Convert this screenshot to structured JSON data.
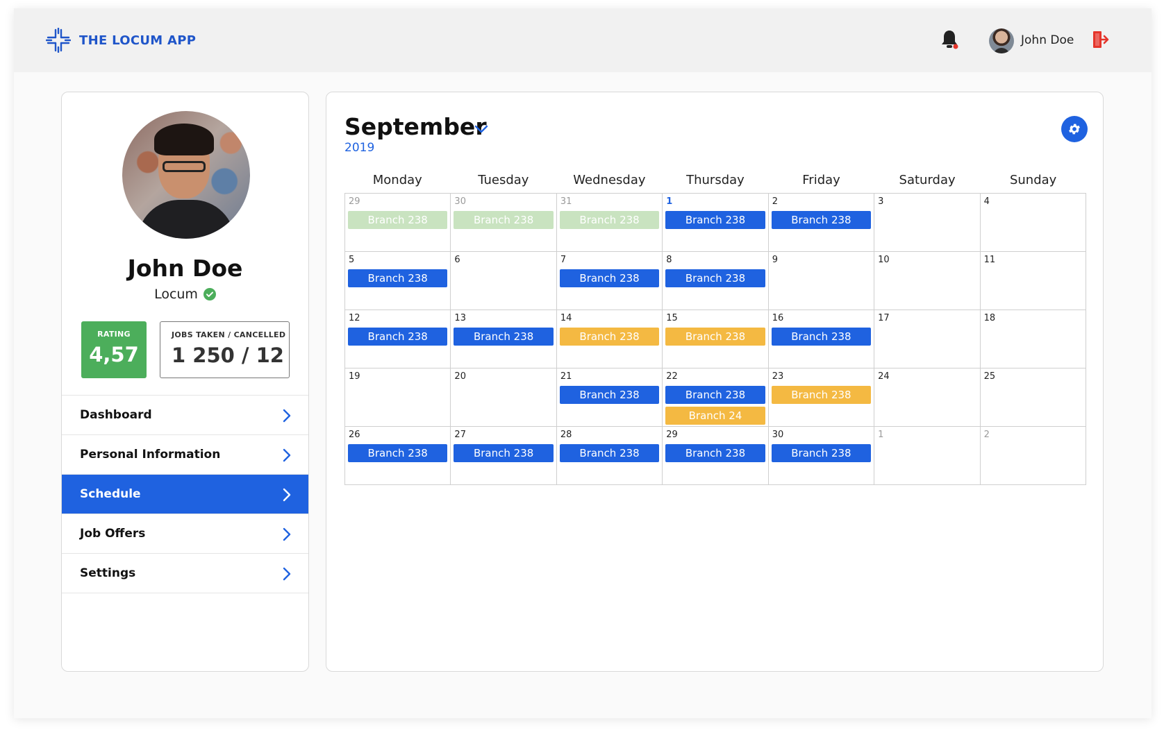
{
  "header": {
    "brand": "THE LOCUM APP",
    "user_name": "John Doe",
    "colors": {
      "brand": "#1f55c9",
      "notification_dot": "#e5352b",
      "logout": "#e5352b"
    }
  },
  "profile": {
    "name": "John Doe",
    "role": "Locum",
    "rating_label": "RATING",
    "rating_value": "4,57",
    "jobs_label": "JOBS TAKEN / CANCELLED",
    "jobs_value": "1 250 / 12",
    "colors": {
      "rating_bg": "#4cae5b",
      "verified": "#4cae5b"
    }
  },
  "menu": [
    {
      "label": "Dashboard",
      "active": false
    },
    {
      "label": "Personal Information",
      "active": false
    },
    {
      "label": "Schedule",
      "active": true
    },
    {
      "label": "Job Offers",
      "active": false
    },
    {
      "label": "Settings",
      "active": false
    }
  ],
  "calendar": {
    "month": "September",
    "year": "2019",
    "weekdays": [
      "Monday",
      "Tuesday",
      "Wednesday",
      "Thursday",
      "Friday",
      "Saturday",
      "Sunday"
    ],
    "event_colors": {
      "blue": "#1f62e0",
      "yellow": "#f4b942",
      "past": "#c9e3c0"
    },
    "cells": [
      {
        "day": "29",
        "state": "muted",
        "events": [
          {
            "label": "Branch 238",
            "style": "past"
          }
        ]
      },
      {
        "day": "30",
        "state": "muted",
        "events": [
          {
            "label": "Branch 238",
            "style": "past"
          }
        ]
      },
      {
        "day": "31",
        "state": "muted",
        "events": [
          {
            "label": "Branch 238",
            "style": "past"
          }
        ]
      },
      {
        "day": "1",
        "state": "today",
        "events": [
          {
            "label": "Branch 238",
            "style": "blue"
          }
        ]
      },
      {
        "day": "2",
        "state": "normal",
        "events": [
          {
            "label": "Branch 238",
            "style": "blue"
          }
        ]
      },
      {
        "day": "3",
        "state": "normal",
        "events": []
      },
      {
        "day": "4",
        "state": "normal",
        "events": []
      },
      {
        "day": "5",
        "state": "normal",
        "events": [
          {
            "label": "Branch 238",
            "style": "blue"
          }
        ]
      },
      {
        "day": "6",
        "state": "normal",
        "events": []
      },
      {
        "day": "7",
        "state": "normal",
        "events": [
          {
            "label": "Branch 238",
            "style": "blue"
          }
        ]
      },
      {
        "day": "8",
        "state": "normal",
        "events": [
          {
            "label": "Branch 238",
            "style": "blue"
          }
        ]
      },
      {
        "day": "9",
        "state": "normal",
        "events": []
      },
      {
        "day": "10",
        "state": "normal",
        "events": []
      },
      {
        "day": "11",
        "state": "normal",
        "events": []
      },
      {
        "day": "12",
        "state": "normal",
        "events": [
          {
            "label": "Branch 238",
            "style": "blue"
          }
        ]
      },
      {
        "day": "13",
        "state": "normal",
        "events": [
          {
            "label": "Branch 238",
            "style": "blue"
          }
        ]
      },
      {
        "day": "14",
        "state": "normal",
        "events": [
          {
            "label": "Branch 238",
            "style": "yellow"
          }
        ]
      },
      {
        "day": "15",
        "state": "normal",
        "events": [
          {
            "label": "Branch 238",
            "style": "yellow"
          }
        ]
      },
      {
        "day": "16",
        "state": "normal",
        "events": [
          {
            "label": "Branch 238",
            "style": "blue"
          }
        ]
      },
      {
        "day": "17",
        "state": "normal",
        "events": []
      },
      {
        "day": "18",
        "state": "normal",
        "events": []
      },
      {
        "day": "19",
        "state": "normal",
        "events": []
      },
      {
        "day": "20",
        "state": "normal",
        "events": []
      },
      {
        "day": "21",
        "state": "normal",
        "events": [
          {
            "label": "Branch 238",
            "style": "blue"
          }
        ]
      },
      {
        "day": "22",
        "state": "normal",
        "events": [
          {
            "label": "Branch 238",
            "style": "blue"
          },
          {
            "label": "Branch 24",
            "style": "yellow"
          }
        ]
      },
      {
        "day": "23",
        "state": "normal",
        "events": [
          {
            "label": "Branch 238",
            "style": "yellow"
          }
        ]
      },
      {
        "day": "24",
        "state": "normal",
        "events": []
      },
      {
        "day": "25",
        "state": "normal",
        "events": []
      },
      {
        "day": "26",
        "state": "normal",
        "events": [
          {
            "label": "Branch 238",
            "style": "blue"
          }
        ]
      },
      {
        "day": "27",
        "state": "normal",
        "events": [
          {
            "label": "Branch 238",
            "style": "blue"
          }
        ]
      },
      {
        "day": "28",
        "state": "normal",
        "events": [
          {
            "label": "Branch 238",
            "style": "blue"
          }
        ]
      },
      {
        "day": "29",
        "state": "normal",
        "events": [
          {
            "label": "Branch 238",
            "style": "blue"
          }
        ]
      },
      {
        "day": "30",
        "state": "normal",
        "events": [
          {
            "label": "Branch 238",
            "style": "blue"
          }
        ]
      },
      {
        "day": "1",
        "state": "muted",
        "events": []
      },
      {
        "day": "2",
        "state": "muted",
        "events": []
      }
    ]
  }
}
